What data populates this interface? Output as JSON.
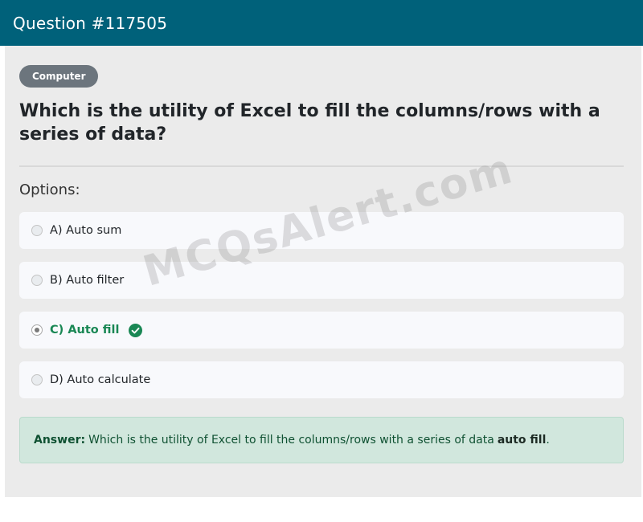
{
  "header": {
    "title": "Question #117505"
  },
  "category": {
    "label": "Computer"
  },
  "question": {
    "text": "Which is the utility of Excel to fill the columns/rows with a series of data?"
  },
  "options_label": "Options:",
  "options": [
    {
      "label": "A) Auto sum",
      "selected": false,
      "correct": false
    },
    {
      "label": "B) Auto filter",
      "selected": false,
      "correct": false
    },
    {
      "label": "C) Auto fill",
      "selected": true,
      "correct": true
    },
    {
      "label": "D) Auto calculate",
      "selected": false,
      "correct": false
    }
  ],
  "answer": {
    "label": "Answer:",
    "text": "Which is the utility of Excel to fill the columns/rows with a series of data",
    "highlight": "auto fill",
    "suffix": "."
  },
  "watermark": "MCQsAlert.com",
  "colors": {
    "header_bg": "#00617a",
    "badge_bg": "#6c757d",
    "correct": "#198754",
    "answer_bg": "#d1e7dd"
  },
  "icons": {
    "correct": "check-circle-icon"
  }
}
